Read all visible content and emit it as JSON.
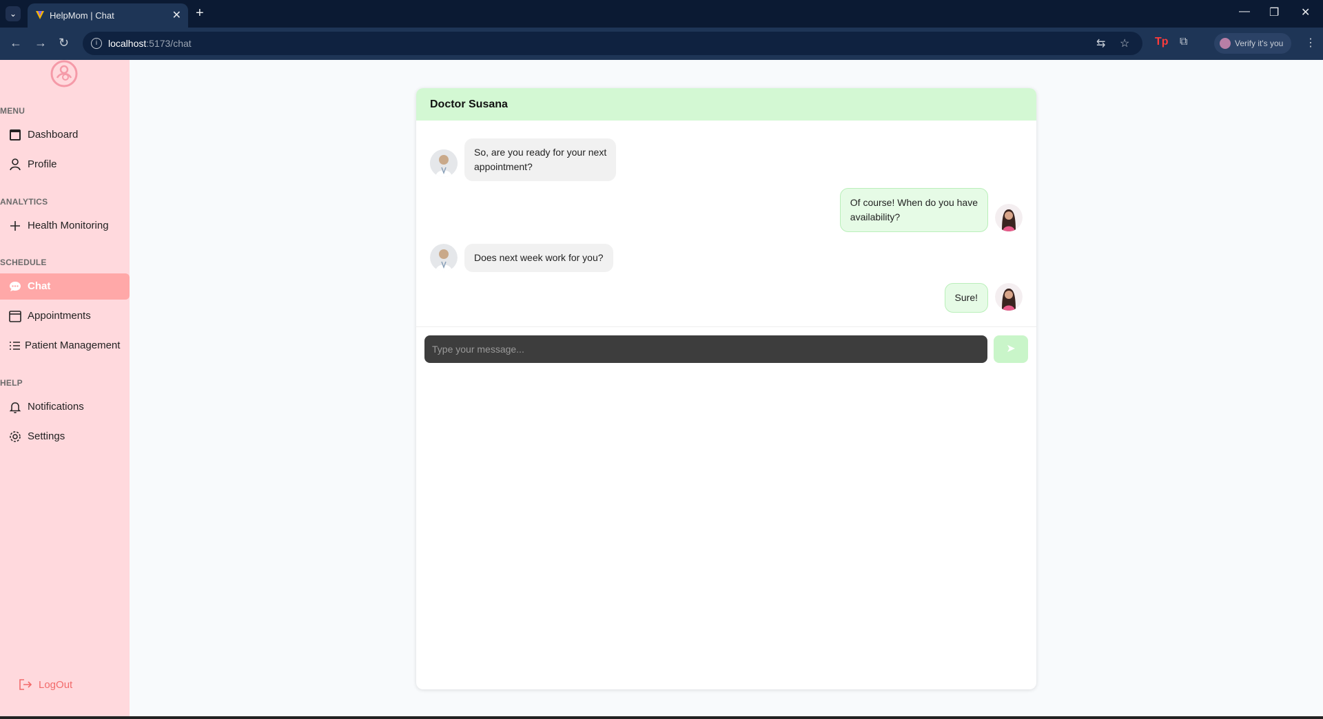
{
  "browser": {
    "tab_title": "HelpMom | Chat",
    "url_host": "localhost",
    "url_path": ":5173/chat",
    "profile_label": "Verify it's you"
  },
  "sidebar": {
    "sections": {
      "menu": "MENU",
      "analytics": "ANALYTICS",
      "schedule": "SCHEDULE",
      "help": "HELP"
    },
    "items": [
      {
        "label": "Dashboard",
        "icon": "dashboard-icon"
      },
      {
        "label": "Profile",
        "icon": "user-icon"
      },
      {
        "label": "Health Monitoring",
        "icon": "plus-icon"
      },
      {
        "label": "Chat",
        "icon": "chat-icon",
        "active": true
      },
      {
        "label": "Appointments",
        "icon": "calendar-icon"
      },
      {
        "label": "Patient Management",
        "icon": "list-icon"
      },
      {
        "label": "Notifications",
        "icon": "bell-icon"
      },
      {
        "label": "Settings",
        "icon": "gear-icon"
      }
    ],
    "logout_label": "LogOut"
  },
  "chat": {
    "contact_name": "Doctor Susana",
    "messages": [
      {
        "from": "doctor",
        "text_line1": "So, are you ready for your next",
        "text_line2": "appointment?"
      },
      {
        "from": "patient",
        "text_line1": "Of course! When do you have",
        "text_line2": "availability?"
      },
      {
        "from": "doctor",
        "text_line1": "Does next week work for you?"
      },
      {
        "from": "patient",
        "text_line1": "Sure!"
      }
    ],
    "input_placeholder": "Type your message...",
    "send_icon": "send-icon"
  },
  "colors": {
    "sidebar_bg": "#ffd9dd",
    "active_item": "#ffa8a8",
    "chat_header": "#d3f8d3",
    "outgoing_bubble": "#e6fbe6",
    "incoming_bubble": "#f1f1f1",
    "logout": "#f26b6b"
  }
}
